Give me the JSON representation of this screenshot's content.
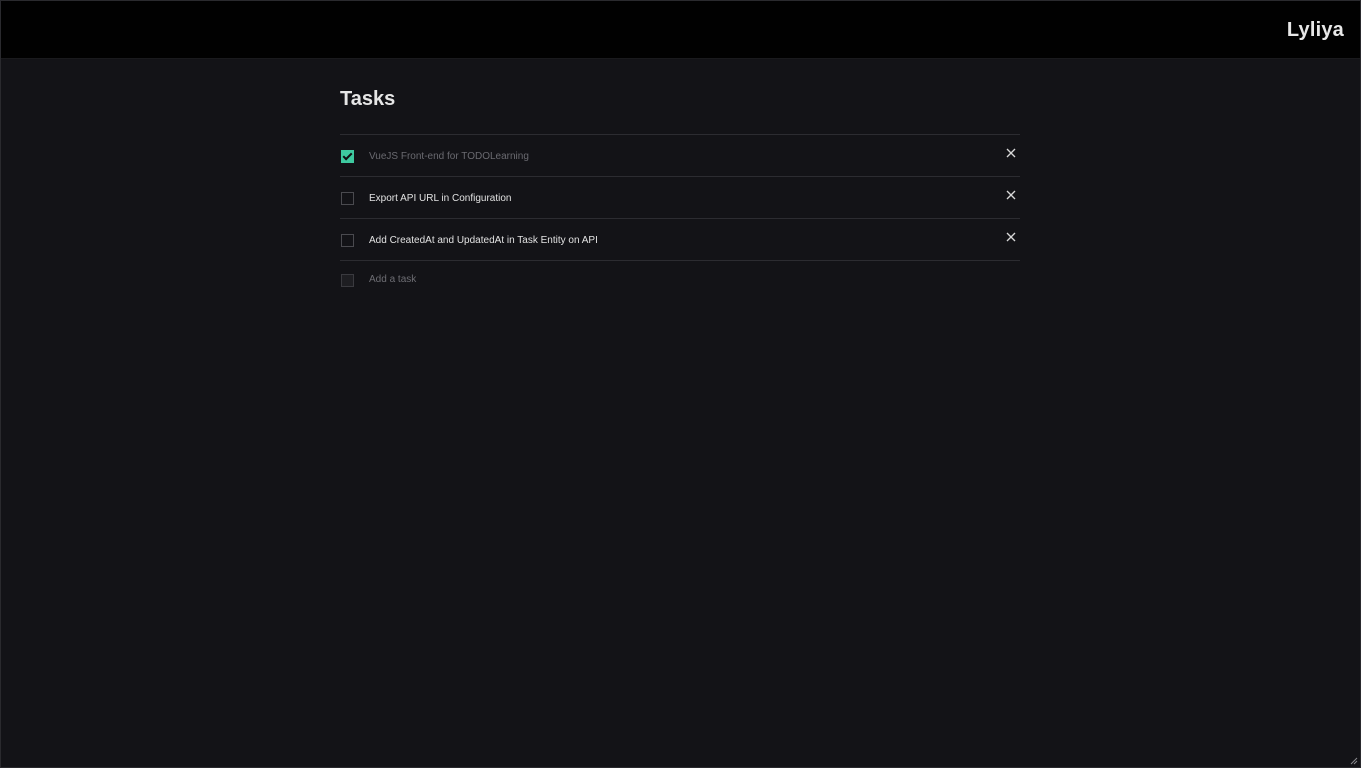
{
  "header": {
    "brand": "Lyliya"
  },
  "main": {
    "title": "Tasks",
    "tasks": [
      {
        "label": "VueJS Front-end for TODOLearning",
        "done": true
      },
      {
        "label": "Export API URL in Configuration",
        "done": false
      },
      {
        "label": "Add CreatedAt and UpdatedAt in Task Entity on API",
        "done": false
      }
    ],
    "add_task": {
      "placeholder": "Add a task",
      "value": ""
    }
  },
  "icons": {
    "delete": "close-icon",
    "check": "check-icon",
    "resize": "resize-grip-icon"
  },
  "colors": {
    "accent": "#3ec9a0",
    "background": "#131317",
    "topbar": "#010101"
  }
}
